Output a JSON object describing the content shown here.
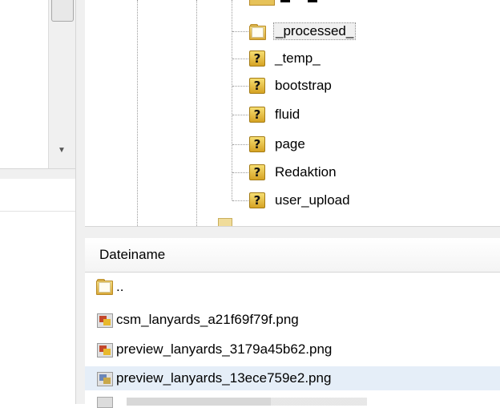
{
  "tree": {
    "items": [
      {
        "label": "_processed_",
        "icon": "folder-icon",
        "selected": true
      },
      {
        "label": "_temp_",
        "icon": "unknown-folder-icon"
      },
      {
        "label": "bootstrap",
        "icon": "unknown-folder-icon"
      },
      {
        "label": "fluid",
        "icon": "unknown-folder-icon"
      },
      {
        "label": "page",
        "icon": "unknown-folder-icon"
      },
      {
        "label": "Redaktion",
        "icon": "unknown-folder-icon"
      },
      {
        "label": "user_upload",
        "icon": "unknown-folder-icon"
      }
    ]
  },
  "file_list": {
    "column_header": "Dateiname",
    "rows": [
      {
        "name": "..",
        "icon": "parent-folder-icon"
      },
      {
        "name": "csm_lanyards_a21f69f79f.png",
        "icon": "png-file-icon"
      },
      {
        "name": "preview_lanyards_3179a45b62.png",
        "icon": "png-file-icon"
      },
      {
        "name": "preview_lanyards_13ece759e2.png",
        "icon": "png-file-icon",
        "selected": true
      }
    ]
  },
  "colors": {
    "selection": "#e5eef8",
    "pane_background": "#ffffff",
    "splitter": "#f0f0f0"
  }
}
